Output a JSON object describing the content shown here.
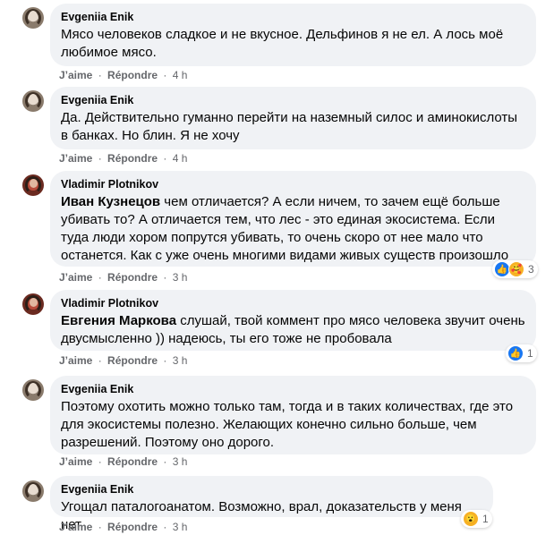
{
  "actions": {
    "like": "J’aime",
    "reply": "Répondre",
    "dot": "·"
  },
  "comments": [
    {
      "author": "Evgeniia Enik",
      "mention": "",
      "text": "Мясо человеков сладкое и не вкусное. Дельфинов я не ел. А лось моё любимое мясо.",
      "time": "4 h"
    },
    {
      "author": "Evgeniia Enik",
      "mention": "",
      "text": "Да. Действительно гуманно перейти на наземный силос и аминокислоты в банках. Но блин. Я не хочу",
      "time": "4 h"
    },
    {
      "author": "Vladimir Plotnikov",
      "mention": "Иван Кузнецов",
      "text": " чем отличается? А если ничем, то зачем ещё больше убивать то? А отличается тем, что лес - это единая экосистема. Если туда люди хором попрутся убивать, то очень скоро от нее мало что останется. Как с уже очень многими видами живых существ произошло",
      "time": "3 h",
      "reactions": {
        "icons": [
          "like-icon",
          "care-icon"
        ],
        "count": "3"
      }
    },
    {
      "author": "Vladimir Plotnikov",
      "mention": "Евгения Маркова",
      "text": " слушай, твой коммент про мясо человека звучит очень двусмысленно )) надеюсь, ты его тоже не пробовала",
      "time": "3 h",
      "reactions": {
        "icons": [
          "like-icon"
        ],
        "count": "1"
      }
    },
    {
      "author": "Evgeniia Enik",
      "mention": "",
      "text": "Поэтому охотить можно только там, тогда и в таких количествах, где это для экосистемы полезно. Желающих конечно сильно больше, чем разрешений. Поэтому оно дорого.",
      "time": "3 h"
    },
    {
      "author": "Evgeniia Enik",
      "mention": "",
      "text": "Угощал паталогоанатом. Возможно, врал, доказательств у меня нет",
      "time": "3 h",
      "reactions": {
        "icons": [
          "wow-icon"
        ],
        "count": "1"
      }
    }
  ]
}
